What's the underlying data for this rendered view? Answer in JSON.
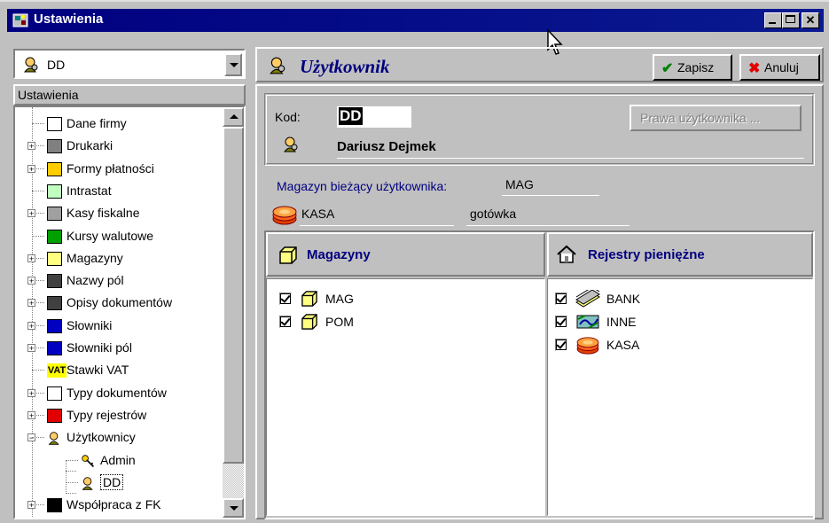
{
  "window": {
    "title": "Ustawienia"
  },
  "left": {
    "combo_value": "DD",
    "tree_header": "Ustawienia",
    "tree_items": [
      {
        "label": "Dane firmy"
      },
      {
        "label": "Drukarki"
      },
      {
        "label": "Formy płatności"
      },
      {
        "label": "Intrastat"
      },
      {
        "label": "Kasy fiskalne"
      },
      {
        "label": "Kursy walutowe"
      },
      {
        "label": "Magazyny"
      },
      {
        "label": "Nazwy pól"
      },
      {
        "label": "Opisy dokumentów"
      },
      {
        "label": "Słowniki"
      },
      {
        "label": "Słowniki pól"
      },
      {
        "label": "Stawki VAT"
      },
      {
        "label": "Typy dokumentów"
      },
      {
        "label": "Typy rejestrów"
      },
      {
        "label": "Użytkownicy"
      },
      {
        "label": "Admin"
      },
      {
        "label": "DD"
      },
      {
        "label": "Współpraca z FK"
      }
    ],
    "vat_icon_text": "VAT"
  },
  "right": {
    "title": "Użytkownik",
    "save_label": "Zapisz",
    "cancel_label": "Anuluj",
    "kod_label": "Kod:",
    "kod_value": "DD",
    "rights_button": "Prawa użytkownika ...",
    "user_name": "Dariusz Dejmek",
    "warehouse_label": "Magazyn bieżący użytkownika:",
    "warehouse_value": "MAG",
    "cash_register": "KASA",
    "payment_form": "gotówka",
    "warehouses_header": "Magazyny",
    "registers_header": "Rejestry pieniężne",
    "warehouses": [
      {
        "label": "MAG",
        "checked": true
      },
      {
        "label": "POM",
        "checked": true
      }
    ],
    "registers": [
      {
        "label": "BANK",
        "checked": true
      },
      {
        "label": "INNE",
        "checked": true
      },
      {
        "label": "KASA",
        "checked": true
      }
    ]
  },
  "colors": {
    "title_bar": "#000080",
    "accent_text": "#000080",
    "window_bg": "#c0c0c0"
  }
}
